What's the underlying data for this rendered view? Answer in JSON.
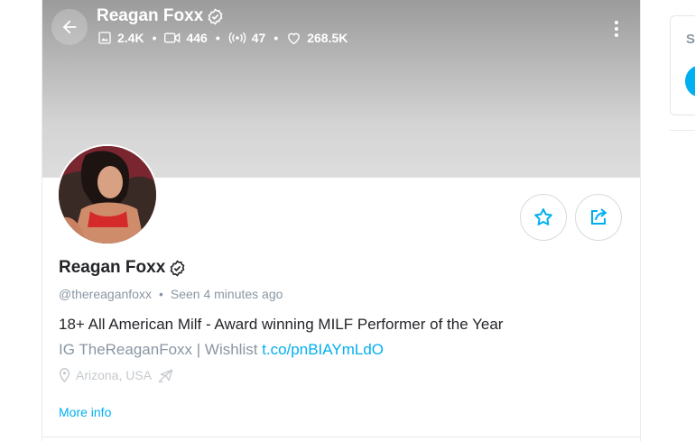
{
  "profile": {
    "display_name": "Reagan Foxx",
    "handle": "@thereaganfoxx",
    "seen_prefix": "Seen",
    "seen_time": "4 minutes ago",
    "bio_line1": "18+ All American Milf - Award winning MILF Performer of the Year",
    "bio_line2_text": "IG TheReaganFoxx | Wishlist ",
    "bio_link": "t.co/pnBIAYmLdO",
    "location": "Arizona, USA",
    "more_info": "More info"
  },
  "stats": {
    "photos": "2.4K",
    "videos": "446",
    "streams": "47",
    "likes": "268.5K"
  },
  "sidebar": {
    "letter": "S"
  },
  "colors": {
    "accent": "#00aff0",
    "text": "#242529",
    "muted": "#8a96a3"
  }
}
